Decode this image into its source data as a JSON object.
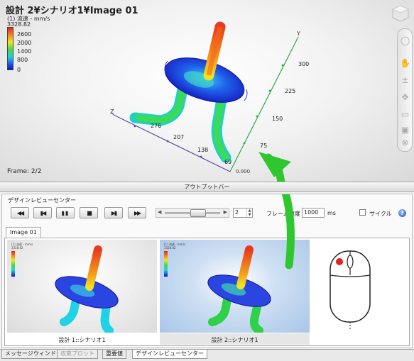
{
  "viewport": {
    "title": "設計 2¥シナリオ1¥Image 01",
    "legend_title": "(1) 流速 - mm/s",
    "legend_max": "3328.82",
    "legend_ticks": [
      "2600",
      "2000",
      "1400",
      "800",
      "0"
    ],
    "frame": "Frame: 2/2",
    "axis_ticks_y": [
      "300",
      "225",
      "150",
      "75"
    ],
    "axis_ticks_x": [
      "276",
      "207",
      "138",
      "69"
    ],
    "axis_y_label": "Y",
    "axis_z_label": "Z",
    "axis_origin_label": "0.000"
  },
  "output_bar": {
    "label": "アウトプットバー"
  },
  "drc": {
    "title": "デザインレビューセンター",
    "frame_value": "2",
    "rate_label": "フレーム速度",
    "rate_value": "1000",
    "rate_unit": "ms",
    "cycle_label": "サイクル",
    "help": "?",
    "tab": "Image 01",
    "thumb1_label": "設計 1::シナリオ1",
    "thumb2_label": "設計 2::シナリオ1"
  },
  "thumbs": {
    "mini_legend_title": "(1) 流速 - mm/s",
    "thumb1_max": "3328.82",
    "thumb2_max": "3328.82"
  },
  "bottom_tabs": [
    "メッセージウィンドウ",
    "収束プロット",
    "重要値",
    "デザインレビューセンター"
  ],
  "colors": {
    "accent_arrow": "#2fc72f",
    "high": "#e8211c",
    "low": "#1010c8"
  }
}
